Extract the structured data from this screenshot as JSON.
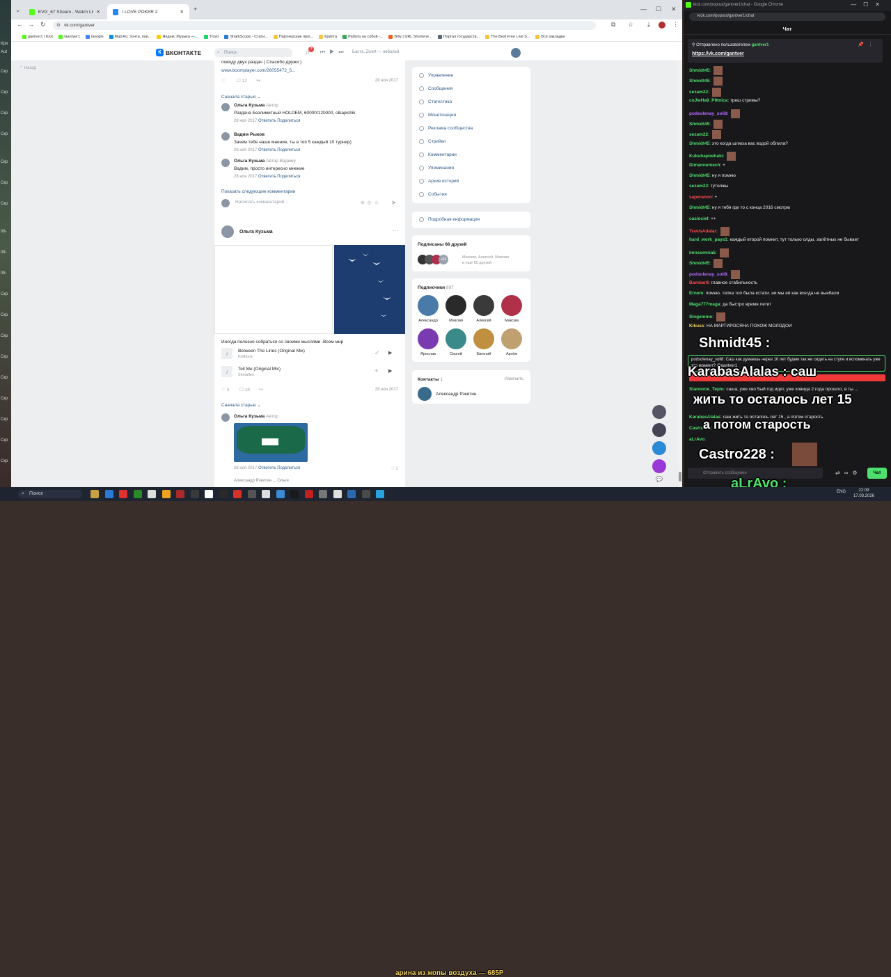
{
  "desktop": {
    "labels": [
      "Кри",
      "Aut",
      "Скр",
      "Скр",
      "Скр",
      "Скр",
      "Скр",
      "Скр",
      "Скр",
      "08-",
      "08-",
      "08-",
      "Скр",
      "Скр",
      "Скр",
      "Скр",
      "Скр",
      "Скр",
      "Скр",
      "Скр",
      "Скр"
    ]
  },
  "browser1": {
    "tabs": [
      {
        "label": "EVG_67 Stream - Watch Live on",
        "color": "#53fc18"
      },
      {
        "label": "I LOVE POKER 2",
        "color": "#2787f5"
      }
    ],
    "url": "vk.com/gantver",
    "bookmarks": [
      {
        "label": "gantver1 | Kick",
        "color": "#53fc18"
      },
      {
        "label": "Gantver1",
        "color": "#53fc18"
      },
      {
        "label": "Google",
        "color": "#4285f4"
      },
      {
        "label": "Mail.Ru: почта, пои...",
        "color": "#168de2"
      },
      {
        "label": "Яндекс Музыка —...",
        "color": "#ffcc00"
      },
      {
        "label": "Trovo",
        "color": "#19d66b"
      },
      {
        "label": "SharkScope - Стати...",
        "color": "#2c7bd6"
      },
      {
        "label": "Партнерские прог...",
        "color": "#f5c542"
      },
      {
        "label": "Крипта",
        "color": "#f5c542"
      },
      {
        "label": "Работа на собой -...",
        "color": "#34a853"
      },
      {
        "label": "Bitly | URL Shortene...",
        "color": "#ee6123"
      },
      {
        "label": "Портал государств...",
        "color": "#5a6a7a"
      },
      {
        "label": "The Best Free Live S...",
        "color": "#f5c542"
      },
      {
        "label": "Все закладки",
        "color": "#f5c542"
      }
    ]
  },
  "vk": {
    "logo": "ВКОНТАКТЕ",
    "search_placeholder": "Поиск",
    "notif_count": "7",
    "now_playing": "Баста, Zivert — неболей",
    "left_item": "Назад",
    "post1": {
      "text_tail": "поводу двух раздач ) Спасибо дружи )",
      "link": "www.boomplayer.com/26055472_5...",
      "comments": "12",
      "date": "28 ноя 2017"
    },
    "sort_label": "Сначала старые",
    "comments": [
      {
        "name": "Ольга Кузьма",
        "tag": "Автор",
        "reply_to": "",
        "text": "Раздача Безлимитный HOLDEM, 60000/120000, olkapishik",
        "date": "28 ноя 2017",
        "reply": "Ответить",
        "share": "Поделиться"
      },
      {
        "name": "Вадим Рыков",
        "tag": "",
        "reply_to": "",
        "text": "Зачем тебе наше мнение, ты в топ 5 каждый 10 турнир)",
        "date": "28 ноя 2017",
        "reply": "Ответить",
        "share": "Поделиться"
      },
      {
        "name": "Ольга Кузьма",
        "tag": "Автор",
        "reply_to": "Вадиму",
        "text": "Вадим, просто интересно мнение",
        "date": "28 ноя 2017",
        "reply": "Ответить",
        "share": "Поделиться"
      }
    ],
    "show_more": "Показать следующие комментарии",
    "comment_placeholder": "Написать комментарий...",
    "post2": {
      "author": "Ольга Кузьма",
      "caption": "Иногда полезно собраться со своими мыслями .Всем мир",
      "tracks": [
        {
          "title": "Between The Lines (Original Mix)",
          "artist": "Fullbone"
        },
        {
          "title": "Tell Me (Original Mix)",
          "artist": "Shmallen"
        }
      ],
      "likes": "3",
      "comments": "18",
      "date": "28 ноя 2017"
    },
    "sort_label2": "Сначала старые",
    "comment4": {
      "name": "Ольга Кузьма",
      "tag": "Автор",
      "date": "28 ноя 2017",
      "reply": "Ответить",
      "share": "Поделиться",
      "likes": "2"
    },
    "partial_name": "Александр Рэкитин ... Ольге",
    "menu": [
      "Управление",
      "Сообщения",
      "Статистика",
      "Монетизация",
      "Реклама сообщества",
      "Стрийки",
      "Комментарии",
      "Упоминания",
      "Архив историй",
      "События"
    ],
    "details": "Подробная информация",
    "friends": {
      "title": "Подписаны 68 друзей",
      "names": "Максим, Алексей, Максим",
      "more": "и ещё 65 друзей",
      "badge": "+65"
    },
    "followers": {
      "title": "Подписчики",
      "count": "897",
      "people": [
        {
          "name": "Александр",
          "color": "#4a7aa8"
        },
        {
          "name": "Максим",
          "color": "#2a2a2a"
        },
        {
          "name": "Алексей",
          "color": "#3a3a3a"
        },
        {
          "name": "Максим",
          "color": "#b0304a"
        },
        {
          "name": "Ярослав",
          "color": "#7a3ab0"
        },
        {
          "name": "Сергей",
          "color": "#3a8a8a"
        },
        {
          "name": "Евгений",
          "color": "#c09040"
        },
        {
          "name": "Артём",
          "color": "#c0a070"
        }
      ]
    },
    "contacts": {
      "title": "Контакты",
      "count": "1",
      "edit": "Изменить",
      "name": "Александр Рэкитин"
    }
  },
  "browser2": {
    "title": "kick.com/popout/gantver1/chat - Google Chrome",
    "url": "kick.com/popout/gantver1/chat",
    "header": "Чат",
    "pinned_by": "Отправлено пользователем",
    "pinned_user": "gantver1",
    "pinned_link": "https://vk.com/gantver",
    "messages": [
      {
        "user": "Shmidt45",
        "text": "",
        "cls": "u-green",
        "emote": true
      },
      {
        "user": "Shmidt45",
        "text": "",
        "cls": "u-green",
        "emote": true
      },
      {
        "user": "sezam22",
        "text": "",
        "cls": "u-green",
        "emote": true
      },
      {
        "user": "coJleHa9_P9tnica",
        "text": "треш стримы?",
        "cls": "u-green",
        "emote": false
      },
      {
        "user": "podsolenay_soli8",
        "text": "",
        "cls": "u-purple",
        "emote": true
      },
      {
        "user": "Shmidt45",
        "text": "",
        "cls": "u-green",
        "emote": true
      },
      {
        "user": "sezam22",
        "text": "",
        "cls": "u-green",
        "emote": true
      },
      {
        "user": "Shmidt45",
        "text": "это когда шлюха вас водой облила?",
        "cls": "u-green",
        "emote": false
      },
      {
        "user": "Kukuhapoehalo",
        "text": "",
        "cls": "u-green",
        "emote": true
      },
      {
        "user": "Dimannemech",
        "text": "+",
        "cls": "u-green",
        "emote": false
      },
      {
        "user": "Shmidt45",
        "text": "ну я помню",
        "cls": "u-green",
        "emote": false
      },
      {
        "user": "sezam22",
        "text": "тутолжы",
        "cls": "u-green",
        "emote": false
      },
      {
        "user": "saperanon",
        "text": "+",
        "cls": "u-red",
        "emote": false
      },
      {
        "user": "Shmidt45",
        "text": "ну я тебя где то с конца 2016 смотрю",
        "cls": "u-green",
        "emote": false
      },
      {
        "user": "casiociel",
        "text": "++",
        "cls": "u-green",
        "emote": false
      },
      {
        "user": "TravisAdalar",
        "text": "",
        "cls": "u-red",
        "emote": true
      },
      {
        "user": "hard_work_pays1",
        "text": "каждый второй помнит, тут только олды, залётных не бывает",
        "cls": "u-green",
        "emote": false
      },
      {
        "user": "imnsomnia5",
        "text": "",
        "cls": "u-green",
        "emote": true
      },
      {
        "user": "Shmidt45",
        "text": "",
        "cls": "u-green",
        "emote": true
      },
      {
        "user": "podsolenay_soli8",
        "text": "",
        "cls": "u-purple",
        "emote": true
      },
      {
        "user": "Bambar8",
        "text": "главное стабильность",
        "cls": "u-red",
        "emote": false
      },
      {
        "user": "Ernem",
        "text": "помню. телка топ была кстати. ни мы её как всегда не выебали",
        "cls": "u-green",
        "emote": false
      },
      {
        "user": "Maga777maga",
        "text": "да быстро время летит",
        "cls": "u-green",
        "emote": false
      },
      {
        "user": "Singemmo",
        "text": "",
        "cls": "u-green",
        "emote": true
      },
      {
        "user": "Kikuss",
        "text": "НА МАРТИРОСЯНА ПОХОЖ МОЛОДОЙ",
        "cls": "u-yellow",
        "emote": false
      }
    ],
    "highlight": "podsolenay_soli8: Саш как думаешь через 10 лет будем так же сидеть на ступе и вспоминать уже это момент? @gantver1",
    "later": [
      {
        "user": "Stanovoe_Teplo",
        "text": "саша, уже сво 5ый год идет, уже ковида 2 года прошло, в ты ..."
      },
      {
        "user": "KarabasAlalas",
        "text": "саш жить то осталось лет 15 , а потом старость"
      },
      {
        "user": "Castro228",
        "text": ""
      },
      {
        "user": "aLrAvo",
        "text": ""
      }
    ],
    "overlay": [
      "Shmidt45 :",
      "KarabasAlalas : саш",
      "жить то осталось лет 15",
      "а потом старость",
      "Castro228 :",
      "aLrAvo :"
    ],
    "send_placeholder": "Отправить сообщение",
    "chat_button": "Чат",
    "donation": "арина из жопы воздуха — 685Р"
  },
  "taskbar": {
    "search": "Поиск",
    "lang": "ENG",
    "time": "22:09",
    "date": "17.03.2026"
  }
}
